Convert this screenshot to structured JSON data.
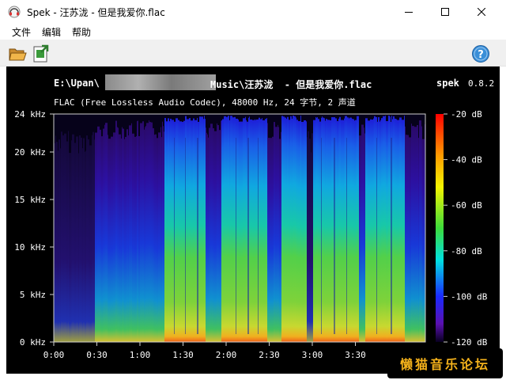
{
  "window": {
    "title": "Spek - 汪苏泷 - 但是我爱你.flac",
    "app_icon": "spek-headphones-icon"
  },
  "menu": {
    "items": [
      "文件",
      "编辑",
      "帮助"
    ]
  },
  "toolbar": {
    "open_icon": "folder-open-icon",
    "save_icon": "save-image-icon",
    "help_icon": "help-icon"
  },
  "spectrogram": {
    "file_path": "E:\\Upan\\",
    "file_path_tail": "Music\\汪苏泷  - 但是我爱你.flac",
    "app_name": "spek",
    "version": "0.8.2",
    "info": "FLAC (Free Lossless Audio Codec), 48000 Hz, 24 字节, 2 声道",
    "freq_labels": [
      "24 kHz",
      "20 kHz",
      "15 kHz",
      "10 kHz",
      "5 kHz",
      "0 kHz"
    ],
    "time_labels": [
      "0:00",
      "0:30",
      "1:00",
      "1:30",
      "2:00",
      "2:30",
      "3:00",
      "3:30"
    ],
    "db_labels": [
      "-20 dB",
      "-40 dB",
      "-60 dB",
      "-80 dB",
      "-100 dB",
      "-120 dB"
    ]
  },
  "watermark": {
    "text": "懒猫音乐论坛"
  },
  "colors": {
    "accent": "#3a8fd8",
    "watermark": "#f5b21b"
  }
}
